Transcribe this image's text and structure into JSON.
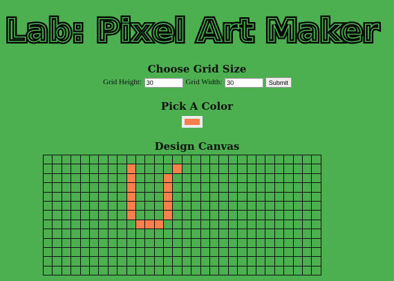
{
  "page": {
    "title": "Lab: Pixel Art Maker"
  },
  "grid_size": {
    "heading": "Choose Grid Size",
    "height_label": "Grid Height:",
    "height_value": "30",
    "width_label": "Grid Width:",
    "width_value": "30",
    "submit_label": "Submit"
  },
  "color": {
    "heading": "Pick A Color",
    "value": "#f97f4c"
  },
  "canvas": {
    "heading": "Design Canvas",
    "visible_rows": 13,
    "visible_cols": 30,
    "filled_color": "#f97f4c",
    "grid_line_color": "#111111",
    "filled_cells": [
      [
        1,
        9
      ],
      [
        1,
        14
      ],
      [
        2,
        9
      ],
      [
        2,
        13
      ],
      [
        3,
        9
      ],
      [
        3,
        13
      ],
      [
        4,
        9
      ],
      [
        4,
        13
      ],
      [
        5,
        9
      ],
      [
        5,
        13
      ],
      [
        6,
        9
      ],
      [
        6,
        13
      ],
      [
        7,
        10
      ],
      [
        7,
        11
      ],
      [
        7,
        12
      ]
    ]
  },
  "colors": {
    "background": "#4caf50"
  }
}
